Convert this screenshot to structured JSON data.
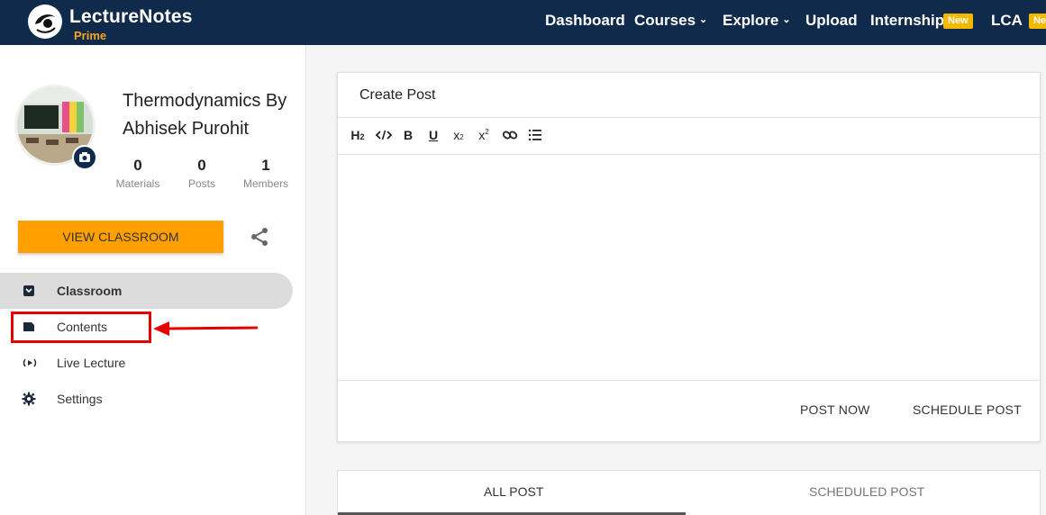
{
  "brand": {
    "name": "LectureNotes",
    "sub": "Prime"
  },
  "nav": {
    "dashboard": "Dashboard",
    "courses": "Courses",
    "explore": "Explore",
    "upload": "Upload",
    "internship": "Internship",
    "internship_badge": "New",
    "lca": "LCA",
    "lca_badge": "New"
  },
  "classroom": {
    "title": "Thermodynamics By Abhisek Purohit",
    "stats": [
      {
        "value": "0",
        "label": "Materials"
      },
      {
        "value": "0",
        "label": "Posts"
      },
      {
        "value": "1",
        "label": "Members"
      }
    ],
    "view_button": "VIEW CLASSROOM"
  },
  "menu": [
    {
      "label": "Classroom",
      "icon": "classroom-icon",
      "active": true
    },
    {
      "label": "Contents",
      "icon": "contents-icon",
      "active": false
    },
    {
      "label": "Live Lecture",
      "icon": "live-icon",
      "active": false
    },
    {
      "label": "Settings",
      "icon": "gear-icon",
      "active": false
    }
  ],
  "post": {
    "header": "Create Post",
    "toolbar": [
      "heading-icon",
      "code-icon",
      "bold-icon",
      "underline-icon",
      "subscript-icon",
      "superscript-icon",
      "link-icon",
      "list-icon"
    ],
    "post_now": "POST NOW",
    "schedule": "SCHEDULE POST"
  },
  "tabs": {
    "all": "ALL POST",
    "scheduled": "SCHEDULED POST"
  },
  "colors": {
    "nav_bg": "#0f2a4a",
    "accent": "#ff9f00",
    "badge": "#f5b800",
    "highlight": "#e60000"
  }
}
